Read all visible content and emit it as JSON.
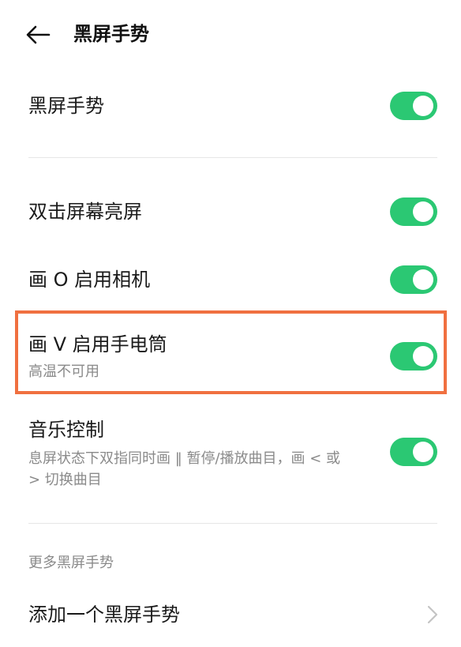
{
  "header": {
    "title": "黑屏手势",
    "back_icon": "arrow-left-icon"
  },
  "colors": {
    "toggle_on": "#2bc873",
    "highlight": "#f07040",
    "subtext": "#8a8a8a"
  },
  "settings": [
    {
      "title": "黑屏手势",
      "enabled": true
    },
    {
      "title": "双击屏幕亮屏",
      "enabled": true
    },
    {
      "title": "画 O 启用相机",
      "enabled": true
    },
    {
      "title": "画 V 启用手电筒",
      "subtitle": "高温不可用",
      "enabled": true
    },
    {
      "title": "音乐控制",
      "subtitle_line1": "息屏状态下双指同时画 ‖ 暂停/播放曲目，画 < 或",
      "subtitle_line2": "> 切换曲目",
      "enabled": true
    }
  ],
  "more_section": {
    "label": "更多黑屏手势",
    "add_item": "添加一个黑屏手势",
    "chevron_icon": "chevron-right-icon"
  }
}
